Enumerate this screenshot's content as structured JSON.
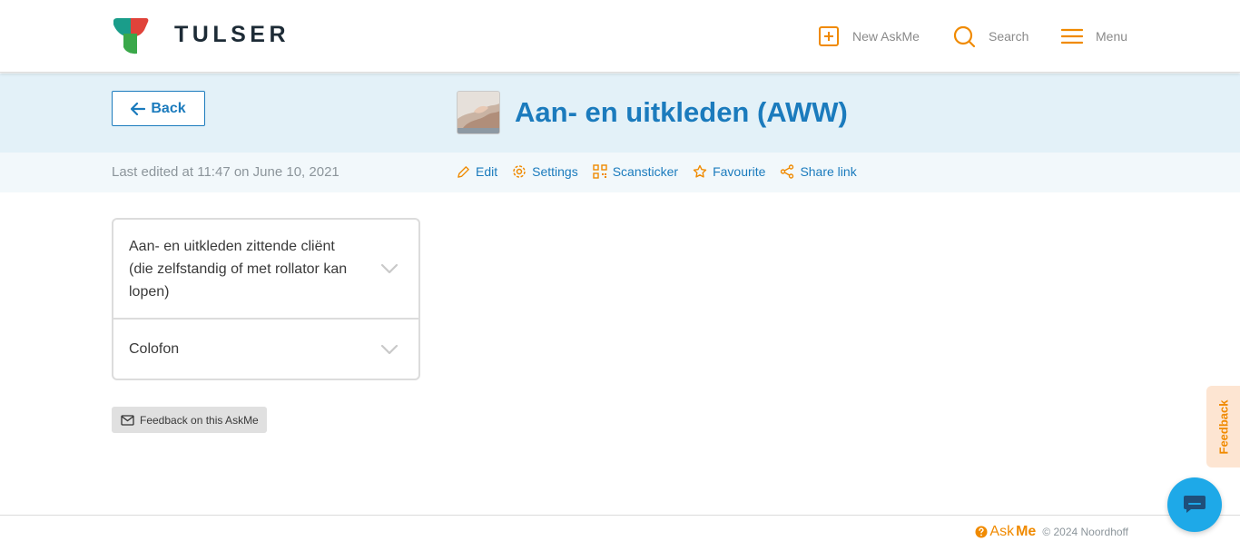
{
  "brand": {
    "name": "TULSER"
  },
  "nav": {
    "new_label": "New AskMe",
    "search_label": "Search",
    "menu_label": "Menu"
  },
  "title_bar": {
    "back_label": "Back",
    "title": "Aan- en uitkleden (AWW)"
  },
  "action_bar": {
    "last_edited": "Last edited at 11:47 on June 10, 2021",
    "actions": [
      {
        "label": "Edit",
        "icon": "pencil-icon"
      },
      {
        "label": "Settings",
        "icon": "gear-icon"
      },
      {
        "label": "Scansticker",
        "icon": "qr-code-icon"
      },
      {
        "label": "Favourite",
        "icon": "star-icon"
      },
      {
        "label": "Share link",
        "icon": "share-icon"
      }
    ]
  },
  "accordion": [
    {
      "label": "Aan- en uitkleden zittende cliënt (die zelfstandig of met rollator kan lopen)"
    },
    {
      "label": "Colofon"
    }
  ],
  "feedback_button": {
    "label": "Feedback on this AskMe"
  },
  "footer": {
    "brand_prefix": "Ask",
    "brand_suffix": "Me",
    "copyright": "© 2024 Noordhoff"
  },
  "feedback_tab": {
    "label": "Feedback"
  },
  "colors": {
    "accent_blue": "#1b7bbd",
    "accent_orange": "#f08a00",
    "title_band": "#e3f1f8",
    "chat_button": "#1ea9e8"
  }
}
